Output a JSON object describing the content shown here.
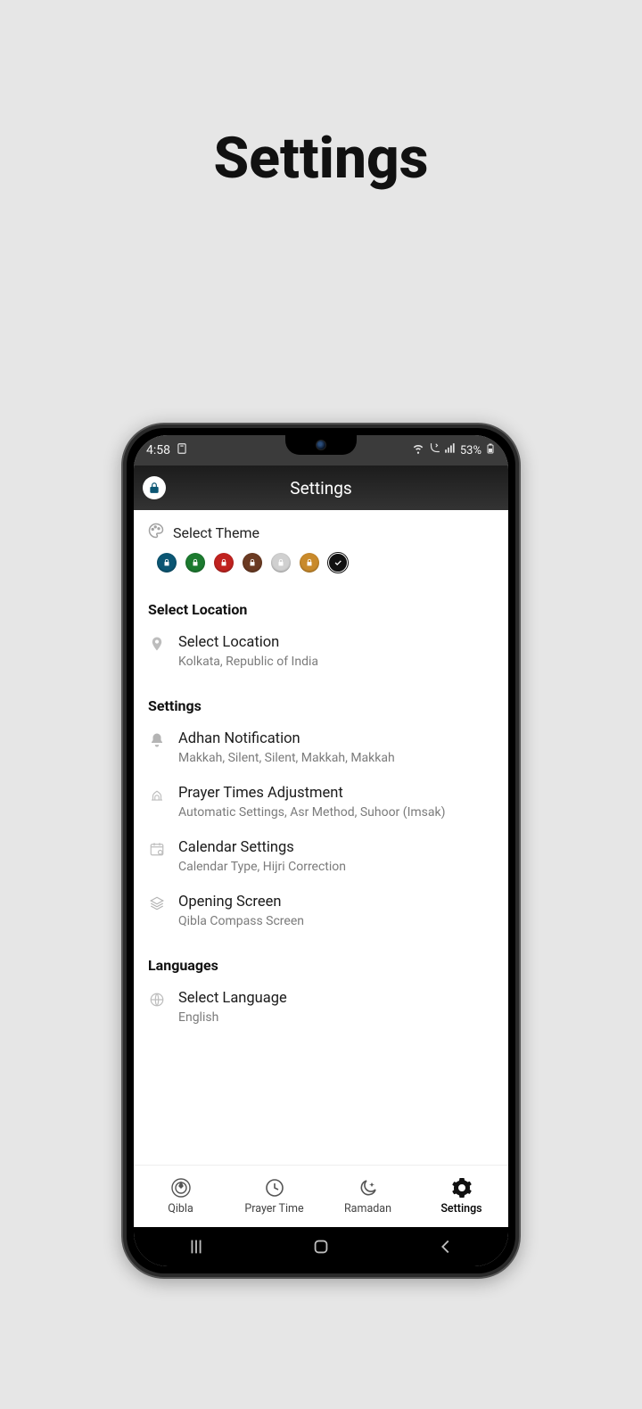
{
  "page": {
    "title": "Settings"
  },
  "statusbar": {
    "time": "4:58",
    "battery_text": "53%"
  },
  "app_header": {
    "title": "Settings"
  },
  "theme": {
    "label": "Select Theme",
    "swatches": [
      {
        "name": "teal",
        "color": "#0b5673",
        "icon": "lock"
      },
      {
        "name": "green",
        "color": "#1c7a2f",
        "icon": "lock"
      },
      {
        "name": "red",
        "color": "#c0221f",
        "icon": "lock"
      },
      {
        "name": "brown",
        "color": "#6b3a22",
        "icon": "lock"
      },
      {
        "name": "silver",
        "color": "#d0d0d0",
        "icon": "lock"
      },
      {
        "name": "gold",
        "color": "#c98a2b",
        "icon": "lock"
      },
      {
        "name": "black",
        "color": "#111111",
        "icon": "check"
      }
    ]
  },
  "sections": {
    "location": {
      "heading": "Select Location",
      "item": {
        "title": "Select Location",
        "sub": "Kolkata, Republic of India"
      }
    },
    "settings": {
      "heading": "Settings",
      "adhan": {
        "title": "Adhan Notification",
        "sub": "Makkah, Silent, Silent, Makkah, Makkah"
      },
      "prayer": {
        "title": "Prayer Times Adjustment",
        "sub": "Automatic Settings, Asr Method, Suhoor (Imsak)"
      },
      "calendar": {
        "title": "Calendar Settings",
        "sub": "Calendar Type, Hijri Correction"
      },
      "opening": {
        "title": "Opening Screen",
        "sub": "Qibla Compass Screen"
      }
    },
    "languages": {
      "heading": "Languages",
      "item": {
        "title": "Select Language",
        "sub": "English"
      }
    }
  },
  "tabs": {
    "qibla": "Qibla",
    "prayer": "Prayer Time",
    "ramadan": "Ramadan",
    "settings": "Settings"
  }
}
